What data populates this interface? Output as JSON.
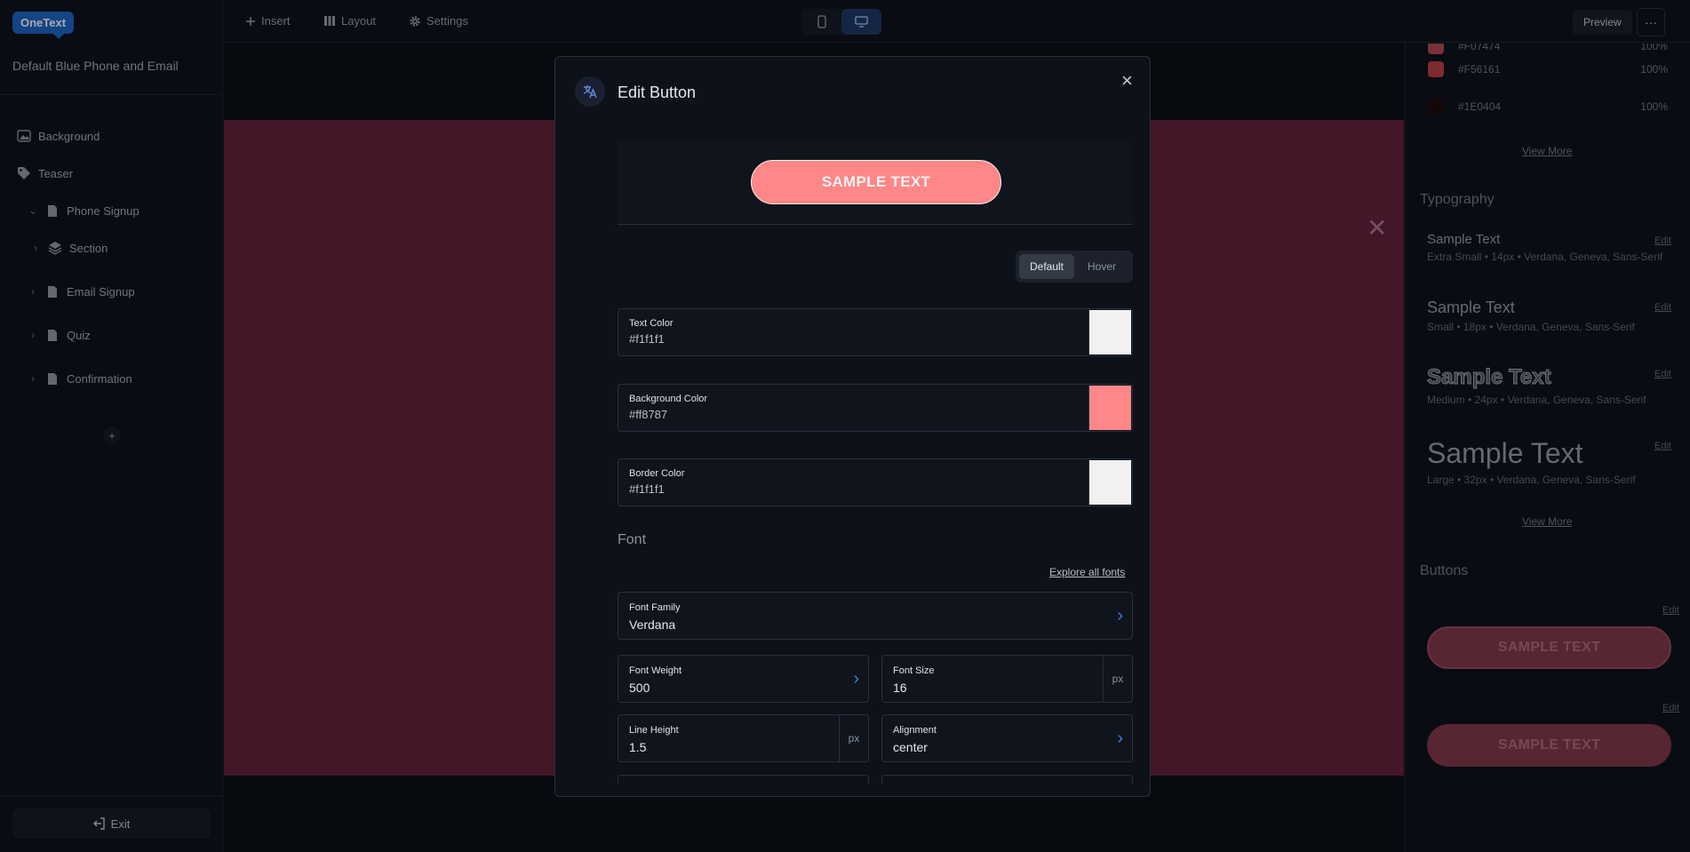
{
  "app": {
    "logo": "OneText",
    "project_title": "Default Blue Phone and Email"
  },
  "sidebar": {
    "items": [
      {
        "label": "Background",
        "icon": "image-icon"
      },
      {
        "label": "Teaser",
        "icon": "tag-icon"
      },
      {
        "label": "Phone Signup",
        "icon": "page-icon",
        "expanded": true
      },
      {
        "label": "Section",
        "icon": "layers-icon"
      },
      {
        "label": "Email Signup",
        "icon": "page-icon"
      },
      {
        "label": "Quiz",
        "icon": "page-icon"
      },
      {
        "label": "Confirmation",
        "icon": "page-icon"
      }
    ],
    "add_label": "+",
    "exit_label": "Exit"
  },
  "toolbar": {
    "insert_label": "Insert",
    "layout_label": "Layout",
    "settings_label": "Settings",
    "device_selected": "desktop",
    "preview_label": "Preview",
    "more_label": "···"
  },
  "modal": {
    "title": "Edit Button",
    "close_label": "×",
    "preview_button_text": "SAMPLE TEXT",
    "state_options": [
      "Default",
      "Hover"
    ],
    "state_selected": "Default",
    "text_color": {
      "label": "Text Color",
      "value": "#f1f1f1"
    },
    "background_color": {
      "label": "Background Color",
      "value": "#ff8787"
    },
    "border_color": {
      "label": "Border Color",
      "value": "#f1f1f1"
    },
    "font_section": "Font",
    "explore_label": "Explore all fonts",
    "font_family": {
      "label": "Font Family",
      "value": "Verdana"
    },
    "font_weight": {
      "label": "Font Weight",
      "value": "500"
    },
    "font_size": {
      "label": "Font Size",
      "value": "16",
      "unit": "px"
    },
    "line_height": {
      "label": "Line Height",
      "value": "1.5",
      "unit": "px"
    },
    "alignment": {
      "label": "Alignment",
      "value": "center"
    }
  },
  "right_panel": {
    "colors": [
      {
        "hex": "#F07474",
        "opacity": "100%"
      },
      {
        "hex": "#F56161",
        "opacity": "100%"
      },
      {
        "hex": "#1E0404",
        "opacity": "100%"
      }
    ],
    "view_more_label": "View More",
    "typography_heading": "Typography",
    "typography": [
      {
        "name": "Sample Text",
        "meta": "Extra Small • 14px • Verdana, Geneva, Sans-Serif"
      },
      {
        "name": "Sample Text",
        "meta": "Small • 18px • Verdana, Geneva, Sans-Serif"
      },
      {
        "name": "Sample Text",
        "meta": "Medium • 24px • Verdana, Geneva, Sans-Serif"
      },
      {
        "name": "Sample Text",
        "meta": "Large • 32px • Verdana, Geneva, Sans-Serif"
      }
    ],
    "edit_label": "Edit",
    "buttons_heading": "Buttons",
    "buttons": [
      {
        "text": "SAMPLE TEXT"
      },
      {
        "text": "SAMPLE TEXT"
      }
    ]
  }
}
